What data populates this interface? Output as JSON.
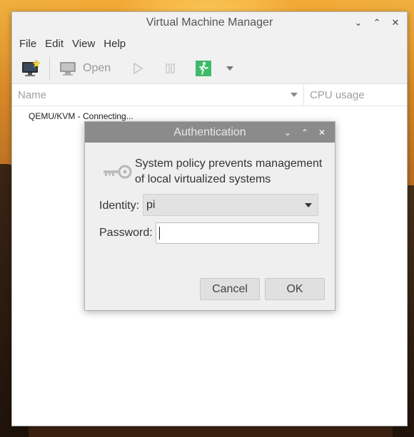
{
  "window": {
    "title": "Virtual Machine Manager",
    "controls": [
      "⌄",
      "⌃",
      "✕"
    ]
  },
  "menubar": {
    "items": [
      "File",
      "Edit",
      "View",
      "Help"
    ]
  },
  "toolbar": {
    "open_label": "Open"
  },
  "list": {
    "columns": [
      "Name",
      "CPU usage"
    ],
    "rows": [
      "QEMU/KVM - Connecting..."
    ]
  },
  "dialog": {
    "title": "Authentication",
    "controls": [
      "⌄",
      "⌃",
      "✕"
    ],
    "message_line1": "System policy prevents management",
    "message_line2": "of local virtualized systems",
    "identity_label": "Identity:",
    "identity_value": "pi",
    "password_label": "Password:",
    "password_value": "",
    "cancel_label": "Cancel",
    "ok_label": "OK"
  },
  "colors": {
    "dialog_titlebar": "#8b8b8b",
    "run_icon_green": "#3dbb6a"
  }
}
